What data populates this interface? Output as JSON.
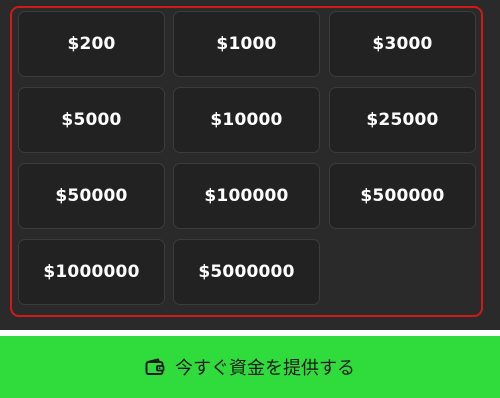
{
  "amounts": [
    {
      "label": "$200"
    },
    {
      "label": "$1000"
    },
    {
      "label": "$3000"
    },
    {
      "label": "$5000"
    },
    {
      "label": "$10000"
    },
    {
      "label": "$25000"
    },
    {
      "label": "$50000"
    },
    {
      "label": "$100000"
    },
    {
      "label": "$500000"
    },
    {
      "label": "$1000000"
    },
    {
      "label": "$5000000"
    }
  ],
  "cta": {
    "label": "今すぐ資金を提供する",
    "icon": "wallet-icon"
  },
  "colors": {
    "background": "#2a2a2a",
    "button_bg": "#222222",
    "button_border": "#3c3c3c",
    "frame_border": "#d01a1a",
    "cta_bg": "#2fdc3c",
    "cta_text": "#1a1a1a",
    "text": "#ffffff"
  }
}
